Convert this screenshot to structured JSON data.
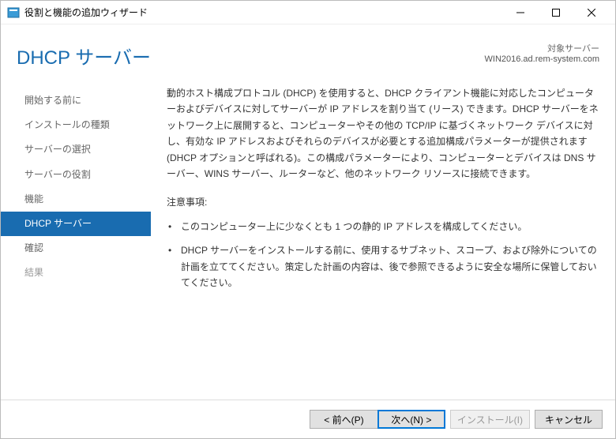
{
  "titlebar": {
    "title": "役割と機能の追加ウィザード"
  },
  "header": {
    "page_title": "DHCP サーバー",
    "target_label": "対象サーバー",
    "target_server": "WIN2016.ad.rem-system.com"
  },
  "sidebar": {
    "items": [
      {
        "label": "開始する前に",
        "enabled": true,
        "active": false
      },
      {
        "label": "インストールの種類",
        "enabled": true,
        "active": false
      },
      {
        "label": "サーバーの選択",
        "enabled": true,
        "active": false
      },
      {
        "label": "サーバーの役割",
        "enabled": true,
        "active": false
      },
      {
        "label": "機能",
        "enabled": true,
        "active": false
      },
      {
        "label": "DHCP サーバー",
        "enabled": true,
        "active": true
      },
      {
        "label": "確認",
        "enabled": true,
        "active": false
      },
      {
        "label": "結果",
        "enabled": false,
        "active": false
      }
    ]
  },
  "content": {
    "description": "動的ホスト構成プロトコル (DHCP) を使用すると、DHCP クライアント機能に対応したコンピューターおよびデバイスに対してサーバーが IP アドレスを割り当て (リース) できます。DHCP サーバーをネットワーク上に展開すると、コンピューターやその他の TCP/IP に基づくネットワーク デバイスに対し、有効な IP アドレスおよびそれらのデバイスが必要とする追加構成パラメーターが提供されます (DHCP オプションと呼ばれる)。この構成パラメーターにより、コンピューターとデバイスは DNS サーバー、WINS サーバー、ルーターなど、他のネットワーク リソースに接続できます。",
    "note_title": "注意事項:",
    "notes": [
      "このコンピューター上に少なくとも 1 つの静的 IP アドレスを構成してください。",
      "DHCP サーバーをインストールする前に、使用するサブネット、スコープ、および除外についての計画を立ててください。策定した計画の内容は、後で参照できるように安全な場所に保管しておいてください。"
    ]
  },
  "footer": {
    "prev": "< 前へ(P)",
    "next": "次へ(N) >",
    "install": "インストール(I)",
    "cancel": "キャンセル"
  }
}
